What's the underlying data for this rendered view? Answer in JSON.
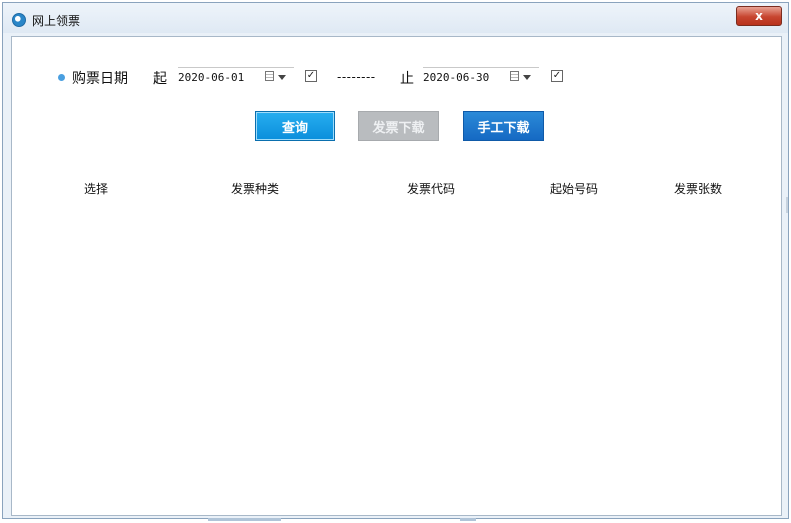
{
  "window": {
    "title": "网上领票",
    "close_label": "x"
  },
  "filter": {
    "date_label": "购票日期",
    "from_label": "起",
    "from_value": "2020-06-01",
    "from_checked": "✓",
    "separator": "--------",
    "to_label": "止",
    "to_value": "2020-06-30",
    "to_checked": "✓"
  },
  "buttons": {
    "query": "查询",
    "download": "发票下载",
    "manual_download": "手工下载"
  },
  "table": {
    "headers": [
      "选择",
      "发票种类",
      "发票代码",
      "起始号码",
      "发票张数"
    ]
  },
  "colors": {
    "accent": "#1569c3",
    "query_button": "#0b8edb",
    "disabled_button": "#b9bcbf",
    "bullet": "#4a9fe0"
  }
}
